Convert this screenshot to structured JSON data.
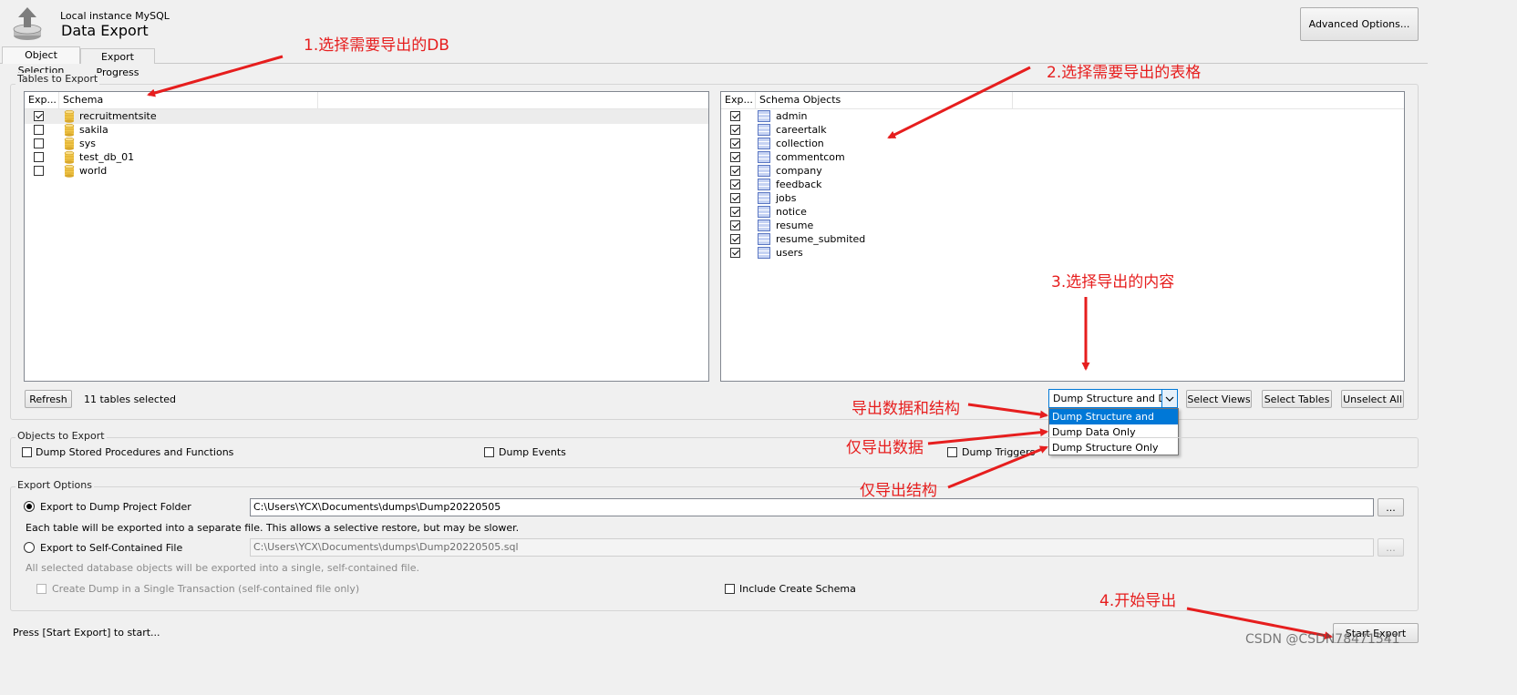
{
  "header": {
    "instance": "Local instance MySQL",
    "title": "Data Export",
    "advanced_button": "Advanced Options..."
  },
  "tabs": [
    {
      "label": "Object Selection",
      "active": true
    },
    {
      "label": "Export Progress",
      "active": false
    }
  ],
  "tables_to_export": {
    "group_label": "Tables to Export",
    "schema_list": {
      "col_export": "Exp...",
      "col_schema": "Schema",
      "items": [
        {
          "name": "recruitmentsite",
          "checked": true
        },
        {
          "name": "sakila",
          "checked": false
        },
        {
          "name": "sys",
          "checked": false
        },
        {
          "name": "test_db_01",
          "checked": false
        },
        {
          "name": "world",
          "checked": false
        }
      ]
    },
    "objects_list": {
      "col_export": "Exp...",
      "col_objects": "Schema Objects",
      "items": [
        {
          "name": "admin",
          "checked": true
        },
        {
          "name": "careertalk",
          "checked": true
        },
        {
          "name": "collection",
          "checked": true
        },
        {
          "name": "commentcom",
          "checked": true
        },
        {
          "name": "company",
          "checked": true
        },
        {
          "name": "feedback",
          "checked": true
        },
        {
          "name": "jobs",
          "checked": true
        },
        {
          "name": "notice",
          "checked": true
        },
        {
          "name": "resume",
          "checked": true
        },
        {
          "name": "resume_submited",
          "checked": true
        },
        {
          "name": "users",
          "checked": true
        }
      ]
    },
    "refresh_button": "Refresh",
    "selected_count": "11 tables selected",
    "dump_select": {
      "value": "Dump Structure and Dat",
      "options": [
        "Dump Structure and Data",
        "Dump Data Only",
        "Dump Structure Only"
      ]
    },
    "select_views": "Select Views",
    "select_tables": "Select Tables",
    "unselect_all": "Unselect All"
  },
  "objects_to_export": {
    "group_label": "Objects to Export",
    "procedures": "Dump Stored Procedures and Functions",
    "events": "Dump Events",
    "triggers": "Dump Triggers"
  },
  "export_options": {
    "group_label": "Export Options",
    "project_folder_label": "Export to Dump Project Folder",
    "project_folder_path": "C:\\Users\\YCX\\Documents\\dumps\\Dump20220505",
    "project_folder_note": "Each table will be exported into a separate file. This allows a selective restore, but may be slower.",
    "self_contained_label": "Export to Self-Contained File",
    "self_contained_path": "C:\\Users\\YCX\\Documents\\dumps\\Dump20220505.sql",
    "self_contained_note": "All selected database objects will be exported into a single, self-contained file.",
    "single_transaction": "Create Dump in a Single Transaction (self-contained file only)",
    "include_schema": "Include Create Schema",
    "browse": "..."
  },
  "status_text": "Press [Start Export] to start...",
  "start_export": "Start Export",
  "annotations": {
    "a1": "1.选择需要导出的DB",
    "a2": "2.选择需要导出的表格",
    "a3": "3.选择导出的内容",
    "a4": "4.开始导出",
    "opt1": "导出数据和结构",
    "opt2": "仅导出数据",
    "opt3": "仅导出结构"
  },
  "watermark": "CSDN @CSDN78471541",
  "colors": {
    "annotation": "#e61e1e",
    "selection": "#0078d7"
  }
}
